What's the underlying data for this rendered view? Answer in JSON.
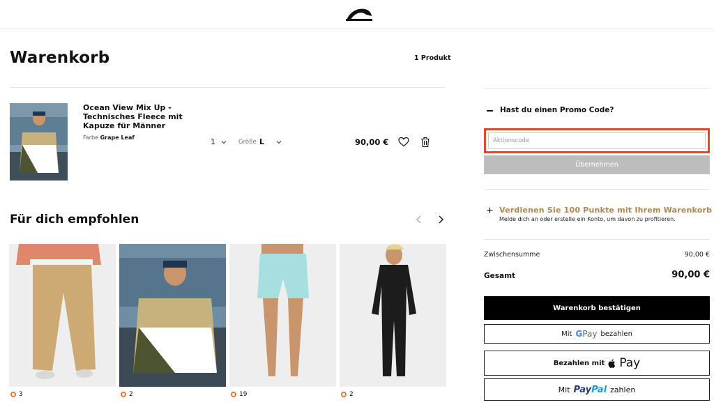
{
  "header": {
    "logo": "quiksilver-logo"
  },
  "cart": {
    "title": "Warenkorb",
    "count": "1 Produkt",
    "item": {
      "name": "Ocean View Mix Up - Technisches Fleece mit Kapuze für Männer",
      "color_label": "Farbe",
      "color_value": "Grape Leaf",
      "qty": "1",
      "size_label": "Größe",
      "size_value": "L",
      "price": "90,00 €"
    }
  },
  "recommended": {
    "title": "Für dich empfohlen",
    "items": [
      {
        "count": "3",
        "image": "beige-pants-orange-sweater"
      },
      {
        "count": "2",
        "image": "fleece-hoodie-man-car"
      },
      {
        "count": "19",
        "image": "light-blue-swim-shorts"
      },
      {
        "count": "2",
        "image": "black-wetsuit"
      }
    ]
  },
  "promo": {
    "label": "Hast du einen Promo Code?",
    "placeholder": "Aktionscode",
    "apply": "Übernehmen"
  },
  "points": {
    "title": "Verdienen Sie 100 Punkte mit Ihrem Warenkorb",
    "subtitle": "Melde dich an oder erstelle ein Konto, um davon zu profitieren."
  },
  "summary": {
    "subtotal_label": "Zwischensumme",
    "subtotal_value": "90,00 €",
    "total_label": "Gesamt",
    "total_value": "90,00 €"
  },
  "checkout": {
    "confirm": "Warenkorb bestätigen",
    "gpay_pre": "Mit",
    "gpay_g": "G",
    "gpay_pay": "Pay",
    "gpay_post": "bezahlen",
    "applepay_pre": "Bezahlen mit",
    "applepay_pay": "Pay",
    "paypal_pre": "Mit",
    "paypal_pay": "Pay",
    "paypal_pal": "Pal",
    "paypal_post": "zahlen"
  },
  "colors": {
    "accent_red": "#e8452c",
    "points_gold": "#b5864a",
    "black": "#000000"
  }
}
